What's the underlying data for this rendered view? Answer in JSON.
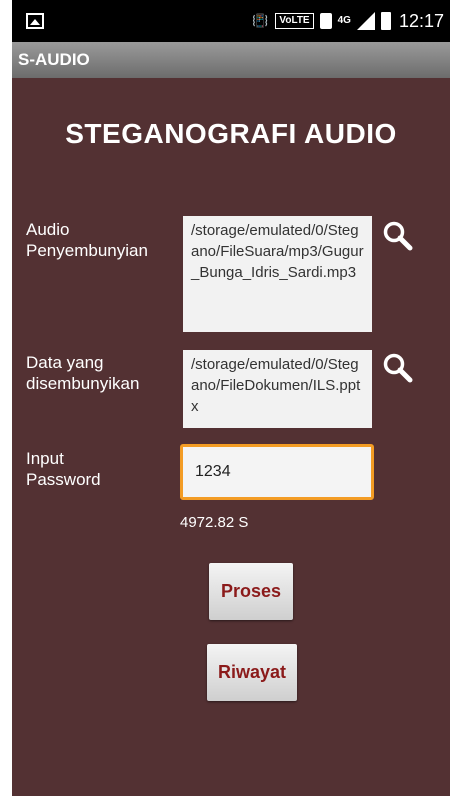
{
  "status_bar": {
    "time": "12:17",
    "volte_label": "VoLTE",
    "network_label": "4G",
    "icons": [
      "gallery-icon",
      "vibrate-icon",
      "sim-icon",
      "signal-icon",
      "battery-icon"
    ]
  },
  "action_bar": {
    "title": "S-AUDIO"
  },
  "main": {
    "heading": "STEGANOGRAFI AUDIO",
    "audio_label_line1": "Audio",
    "audio_label_line2": "Penyembunyian",
    "audio_path": "/storage/emulated/0/Stegano/FileSuara/mp3/Gugur_Bunga_Idris_Sardi.mp3",
    "data_label_line1": "Data yang",
    "data_label_line2": "disembunyikan",
    "data_path": "/storage/emulated/0/Stegano/FileDokumen/ILS.pptx",
    "password_label_line1": "Input",
    "password_label_line2": "Password",
    "password_value": "1234",
    "timing_text": "4972.82 S",
    "process_button": "Proses",
    "history_button": "Riwayat"
  },
  "colors": {
    "background": "#533133",
    "accent": "#f39c24",
    "button_text": "#8b1a1a"
  }
}
